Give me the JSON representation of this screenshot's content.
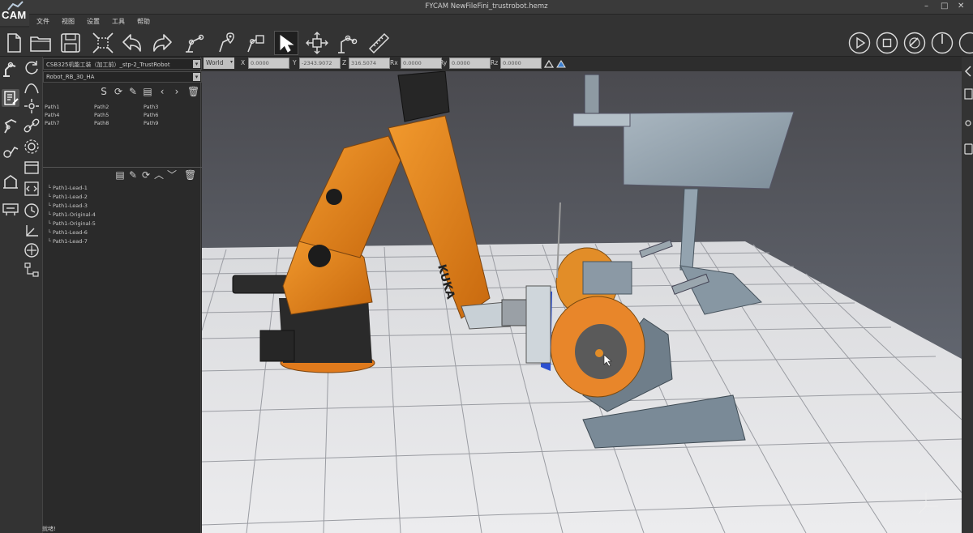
{
  "app": {
    "logo": "CAM",
    "title": "FYCAM   NewFileFini_trustrobot.hemz",
    "window_controls": [
      "–",
      "□",
      "✕"
    ]
  },
  "menu": [
    "文件",
    "视图",
    "设置",
    "工具",
    "帮助"
  ],
  "toolbar": {
    "left_icons": [
      "new-file-icon",
      "open-folder-icon",
      "save-icon",
      "fit-view-icon",
      "undo-icon",
      "redo-icon",
      "robot-path-icon",
      "pin-path-icon",
      "tool-frame-icon",
      "select-cursor-icon",
      "move-axis-icon",
      "joint-icon",
      "ruler-icon"
    ],
    "right_icons": [
      "play-icon",
      "stop-icon",
      "reset-icon",
      "half-icon",
      "full-icon"
    ]
  },
  "coordinates": {
    "frame": "World",
    "axes": [
      {
        "label": "X",
        "value": "0.0000"
      },
      {
        "label": "Y",
        "value": "-2343.9072"
      },
      {
        "label": "Z",
        "value": "316.5074"
      },
      {
        "label": "Rx",
        "value": "0.0000"
      },
      {
        "label": "Ry",
        "value": "0.0000"
      },
      {
        "label": "Rz",
        "value": "0.0000"
      }
    ]
  },
  "panel": {
    "project_select": "CSB325机能工装（加工前）_stp-2_TrustRobot",
    "robot_select": "Robot_RB_30_HA",
    "paths": [
      "Path1",
      "Path2",
      "Path3",
      "Path4",
      "Path5",
      "Path6",
      "Path7",
      "Path8",
      "Path9"
    ],
    "tree": [
      "Path1-Lead-1",
      "Path1-Lead-2",
      "Path1-Lead-3",
      "Path1-Original-4",
      "Path1-Original-5",
      "Path1-Lead-6",
      "Path1-Lead-7"
    ],
    "status": "就绪!"
  },
  "scene": {
    "robot_brand": "KUKA"
  },
  "colors": {
    "robot_orange": "#e8861a",
    "fixture_steel": "#8fa0ad",
    "floor": "#e4e4e6",
    "sky_top": "#4b4b50"
  }
}
